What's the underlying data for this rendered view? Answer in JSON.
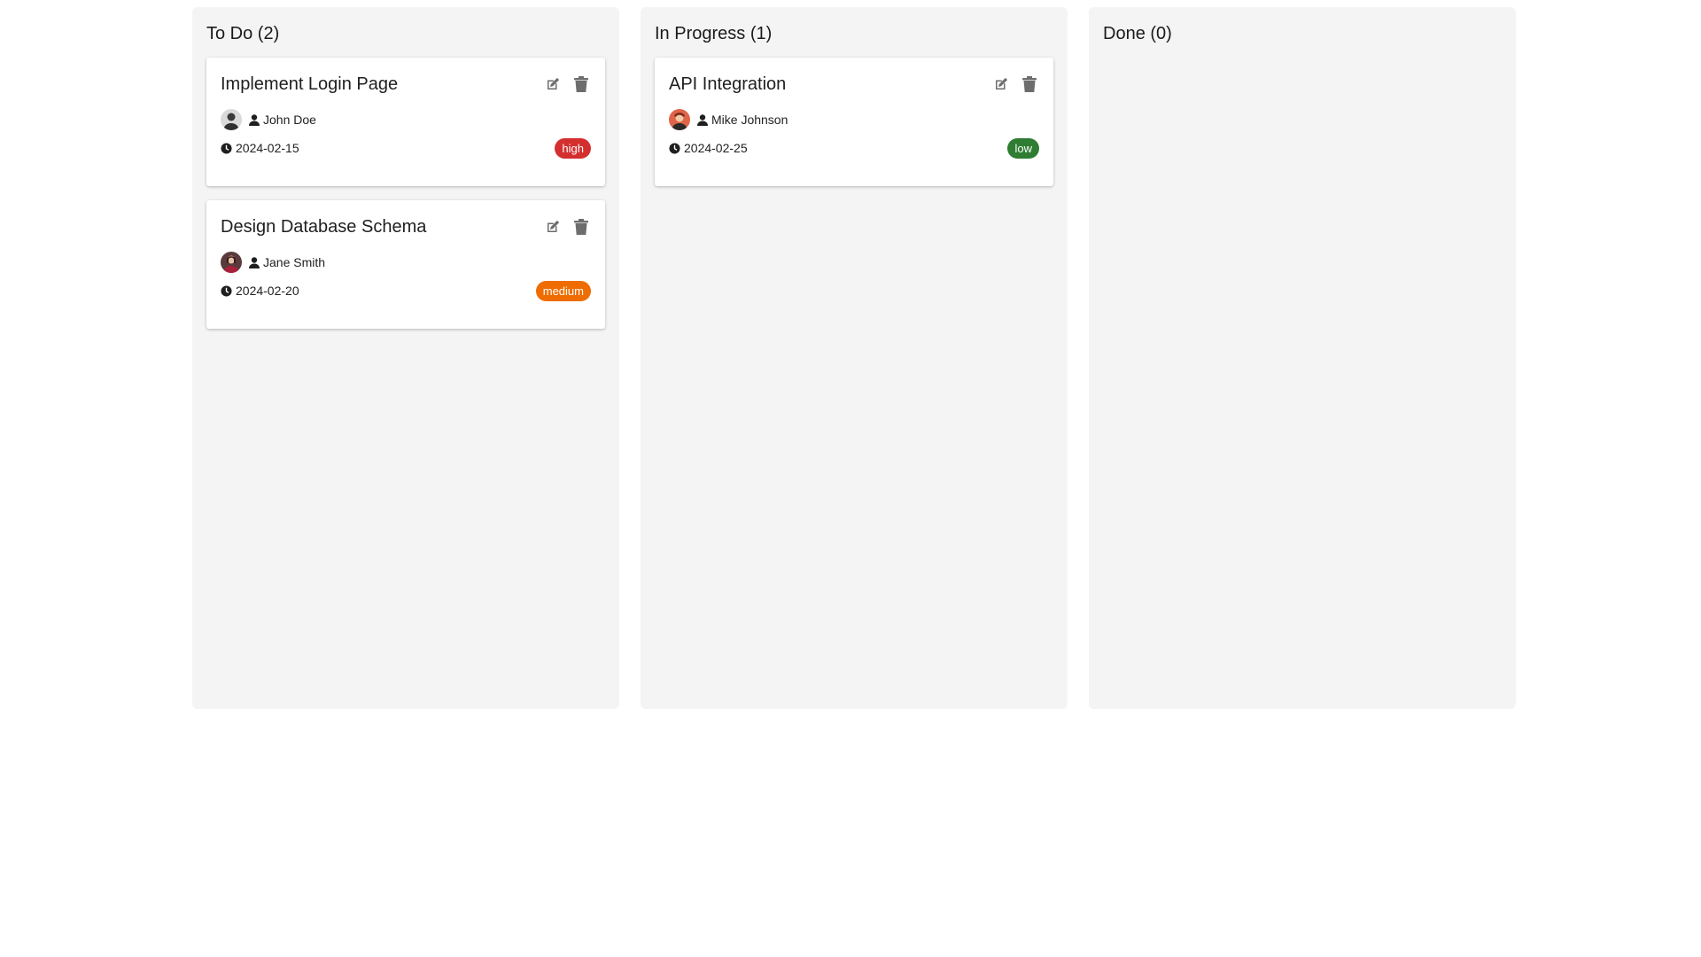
{
  "columns": [
    {
      "title": "To Do (2)",
      "cards": [
        {
          "title": "Implement Login Page",
          "assignee": "John Doe",
          "due_date": "2024-02-15",
          "priority": "high",
          "priority_color": "#d32f2f"
        },
        {
          "title": "Design Database Schema",
          "assignee": "Jane Smith",
          "due_date": "2024-02-20",
          "priority": "medium",
          "priority_color": "#ef6c00"
        }
      ]
    },
    {
      "title": "In Progress (1)",
      "cards": [
        {
          "title": "API Integration",
          "assignee": "Mike Johnson",
          "due_date": "2024-02-25",
          "priority": "low",
          "priority_color": "#2e7d32"
        }
      ]
    },
    {
      "title": "Done (0)",
      "cards": []
    }
  ],
  "icons": {
    "edit": "edit-icon",
    "delete": "trash-icon",
    "person": "person-icon",
    "clock": "clock-icon"
  },
  "colors": {
    "column_background": "#f4f4f4",
    "card_background": "#ffffff",
    "action_icon": "#6d6d6d"
  }
}
